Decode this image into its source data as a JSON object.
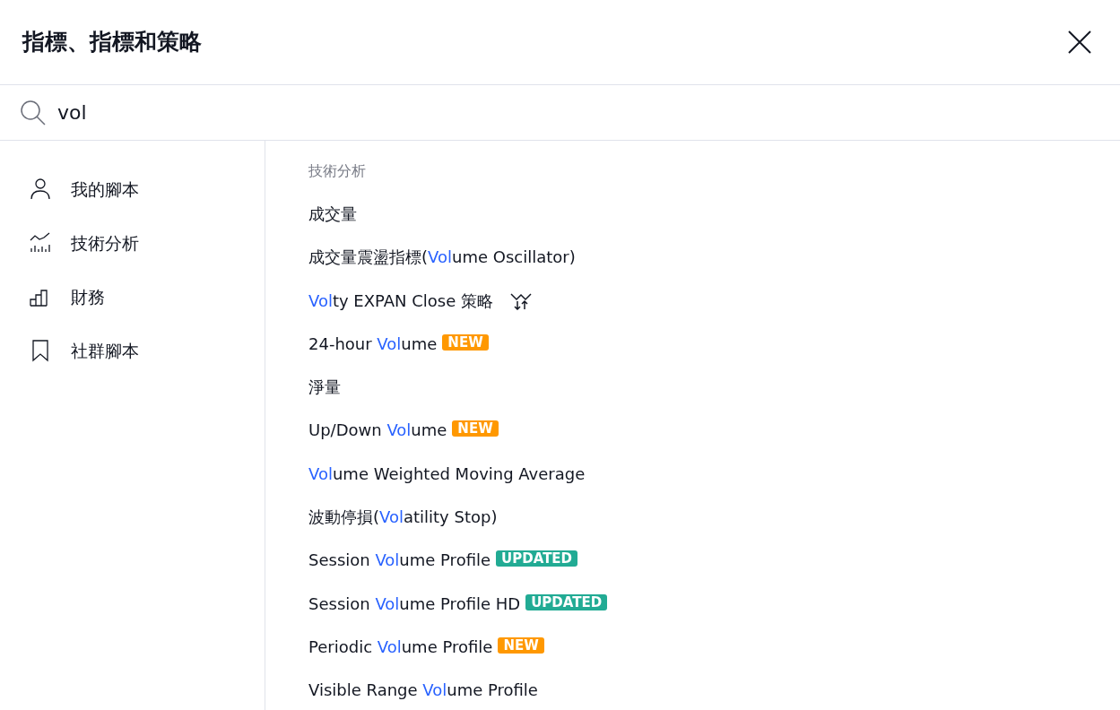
{
  "dialog": {
    "title": "指標、指標和策略"
  },
  "search": {
    "value": "vol"
  },
  "sidebar": {
    "items": [
      {
        "label": "我的腳本",
        "selected": false
      },
      {
        "label": "技術分析",
        "selected": false
      },
      {
        "label": "財務",
        "selected": false
      },
      {
        "label": "社群腳本",
        "selected": false
      }
    ]
  },
  "results": {
    "section_title": "技術分析",
    "items": [
      {
        "segments": [
          {
            "text": "成交量",
            "match": false
          }
        ]
      },
      {
        "segments": [
          {
            "text": "成交量震盪指標(",
            "match": false
          },
          {
            "text": "Vol",
            "match": true
          },
          {
            "text": "ume Oscillator)",
            "match": false
          }
        ]
      },
      {
        "segments": [
          {
            "text": "Vol",
            "match": true
          },
          {
            "text": "ty EXPAN Close 策略",
            "match": false
          }
        ],
        "strategy": true
      },
      {
        "segments": [
          {
            "text": "24-hour ",
            "match": false
          },
          {
            "text": "Vol",
            "match": true
          },
          {
            "text": "ume",
            "match": false
          }
        ],
        "badge": {
          "kind": "new",
          "text": "NEW"
        }
      },
      {
        "segments": [
          {
            "text": "淨量",
            "match": false
          }
        ]
      },
      {
        "segments": [
          {
            "text": "Up/Down ",
            "match": false
          },
          {
            "text": "Vol",
            "match": true
          },
          {
            "text": "ume",
            "match": false
          }
        ],
        "badge": {
          "kind": "new",
          "text": "NEW"
        }
      },
      {
        "segments": [
          {
            "text": "Vol",
            "match": true
          },
          {
            "text": "ume Weighted Moving Average",
            "match": false
          }
        ]
      },
      {
        "segments": [
          {
            "text": "波動停損(",
            "match": false
          },
          {
            "text": "Vol",
            "match": true
          },
          {
            "text": "atility Stop)",
            "match": false
          }
        ]
      },
      {
        "segments": [
          {
            "text": "Session ",
            "match": false
          },
          {
            "text": "Vol",
            "match": true
          },
          {
            "text": "ume Profile",
            "match": false
          }
        ],
        "badge": {
          "kind": "updated",
          "text": "UPDATED"
        }
      },
      {
        "segments": [
          {
            "text": "Session ",
            "match": false
          },
          {
            "text": "Vol",
            "match": true
          },
          {
            "text": "ume Profile HD",
            "match": false
          }
        ],
        "badge": {
          "kind": "updated",
          "text": "UPDATED"
        }
      },
      {
        "segments": [
          {
            "text": "Periodic ",
            "match": false
          },
          {
            "text": "Vol",
            "match": true
          },
          {
            "text": "ume Profile",
            "match": false
          }
        ],
        "badge": {
          "kind": "new",
          "text": "NEW"
        }
      },
      {
        "segments": [
          {
            "text": "Visible Range ",
            "match": false
          },
          {
            "text": "Vol",
            "match": true
          },
          {
            "text": "ume Profile",
            "match": false
          }
        ]
      }
    ]
  }
}
